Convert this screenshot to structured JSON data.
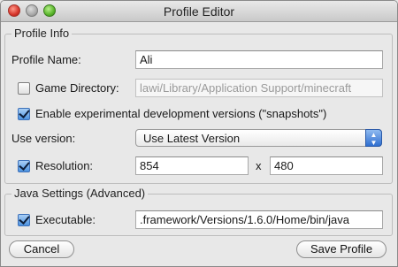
{
  "window": {
    "title": "Profile Editor"
  },
  "profile_info": {
    "group_title": "Profile Info",
    "profile_name_label": "Profile Name:",
    "profile_name_value": "Ali",
    "game_directory_label": "Game Directory:",
    "game_directory_checked": false,
    "game_directory_value": "lawi/Library/Application Support/minecraft",
    "snapshots_label": "Enable experimental development versions (\"snapshots\")",
    "snapshots_checked": true,
    "use_version_label": "Use version:",
    "use_version_value": "Use Latest Version",
    "resolution_label": "Resolution:",
    "resolution_checked": true,
    "resolution_width": "854",
    "resolution_x": "x",
    "resolution_height": "480"
  },
  "java_settings": {
    "group_title": "Java Settings (Advanced)",
    "executable_label": "Executable:",
    "executable_checked": true,
    "executable_value": ".framework/Versions/1.6.0/Home/bin/java"
  },
  "footer": {
    "cancel_label": "Cancel",
    "save_label": "Save Profile"
  }
}
